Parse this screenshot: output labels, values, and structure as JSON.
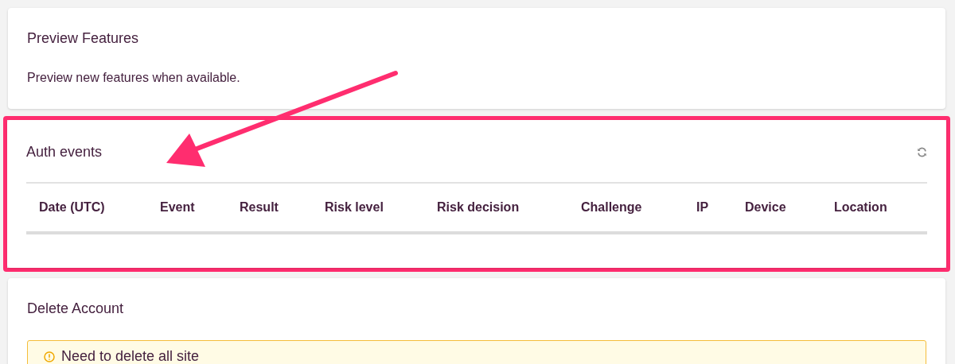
{
  "preview_features": {
    "title": "Preview Features",
    "description": "Preview new features when available."
  },
  "auth_events": {
    "title": "Auth events",
    "highlighted": true,
    "columns": [
      "Date (UTC)",
      "Event",
      "Result",
      "Risk level",
      "Risk decision",
      "Challenge",
      "IP",
      "Device",
      "Location"
    ]
  },
  "delete_account": {
    "title": "Delete Account",
    "warning": "Need to delete all site"
  }
}
